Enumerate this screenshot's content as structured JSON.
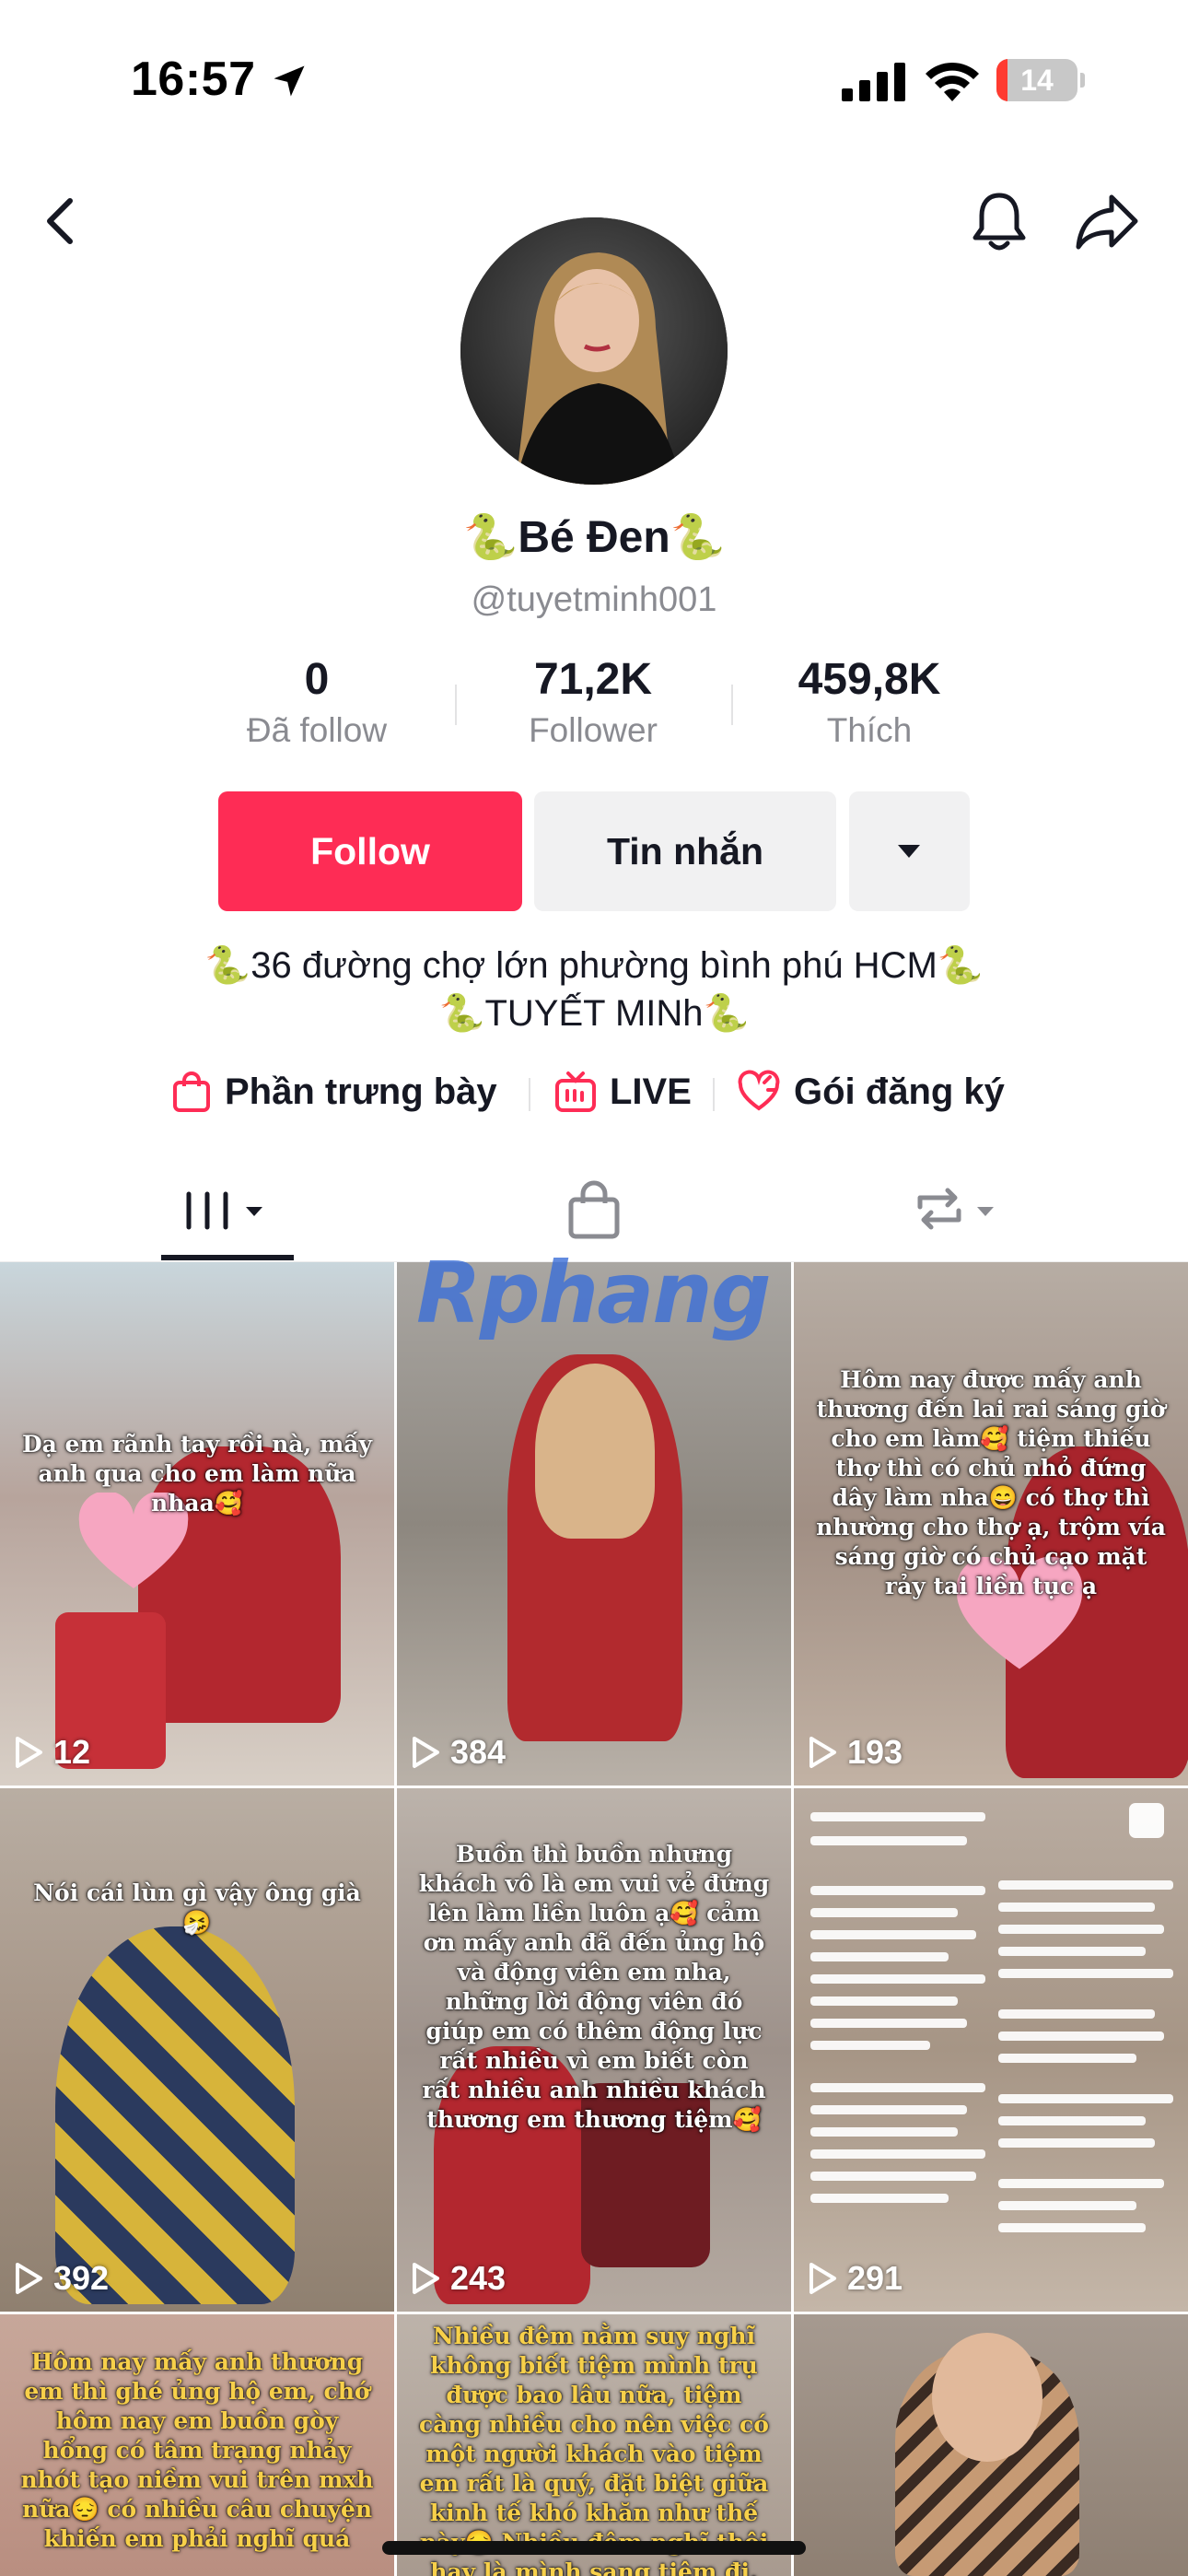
{
  "status_bar": {
    "time": "16:57",
    "battery_level": "14",
    "battery_fraction": 0.14,
    "icons": [
      "location-arrow-icon",
      "cellular-signal-icon",
      "wifi-icon",
      "battery-icon"
    ]
  },
  "nav": {
    "icons": [
      "back-chevron-icon",
      "bell-icon",
      "share-icon"
    ]
  },
  "profile": {
    "display_name": "🐍Bé Đen🐍",
    "username": "@tuyetminh001",
    "stats": [
      {
        "value": "0",
        "label": "Đã follow"
      },
      {
        "value": "71,2K",
        "label": "Follower"
      },
      {
        "value": "459,8K",
        "label": "Thích"
      }
    ],
    "buttons": {
      "follow": "Follow",
      "message": "Tin nhắn"
    },
    "bio_lines": [
      "🐍36 đường chợ lớn phường bình phú HCM🐍",
      "🐍TUYẾT MINh🐍"
    ],
    "links": [
      {
        "label": "Phần trưng bày",
        "icon": "shopping-bag-icon"
      },
      {
        "label": "LIVE",
        "icon": "live-tv-icon"
      },
      {
        "label": "Gói đăng ký",
        "icon": "subscription-icon"
      }
    ]
  },
  "tabs": [
    {
      "name": "videos",
      "icon": "grid-lines-icon",
      "active": true
    },
    {
      "name": "shop",
      "icon": "bag-icon",
      "active": false
    },
    {
      "name": "reposts",
      "icon": "repost-icon",
      "active": false
    }
  ],
  "watermark": "Rphang",
  "videos": [
    {
      "caption": "Dạ em rãnh tay rồi nà, mấy anh qua cho em làm nữa nhaa🥰",
      "views": "12"
    },
    {
      "caption": "",
      "views": "384"
    },
    {
      "caption": "Hôm nay được mấy anh thương đến lai rai sáng giờ cho em làm🥰 tiệm thiếu thợ thì có chủ nhỏ đứng dây làm nha😄 có thợ thì nhường cho thợ ạ, trộm vía sáng giờ có chủ cạo mặt rảy tai liền tục ạ",
      "views": "193"
    },
    {
      "caption": "Nói cái lùn gì vậy ông già🤧",
      "views": "392"
    },
    {
      "caption": "Buồn thì buồn nhưng khách vô là em vui vẻ đứng lên làm liền luôn ạ🥰 cảm ơn mấy anh đã đến ủng hộ và động viên em nha, những lời động viên đó giúp em có thêm động lực rất nhiều vì em biết còn rất nhiều anh nhiều khách thương em thương tiệm🥰",
      "views": "243"
    },
    {
      "caption": "",
      "views": "291"
    },
    {
      "caption": "Hôm nay mấy anh thương em thì ghé ủng hộ em, chớ hôm nay em buồn gòy hổng có tâm trạng nhảy nhót tạo niềm vui trên mxh nữa😔 có nhiều câu chuyện khiến em phải nghĩ quá",
      "views": ""
    },
    {
      "caption": "Nhiều đêm nằm suy nghĩ không biết tiệm mình trụ được bao lâu nữa, tiệm càng nhiều cho nên việc có một người khách vào tiệm em rất là quý, đặt biệt giữa kinh tế khó khăn như thế này😔 Nhiều đêm nghĩ thôi hay là mình sang tiệm đi, đi làm",
      "views": ""
    },
    {
      "caption": "",
      "views": ""
    }
  ],
  "colors": {
    "accent": "#fe2c55",
    "text_primary": "#161823",
    "text_secondary": "#8a8b91",
    "button_secondary": "#f1f1f2"
  }
}
